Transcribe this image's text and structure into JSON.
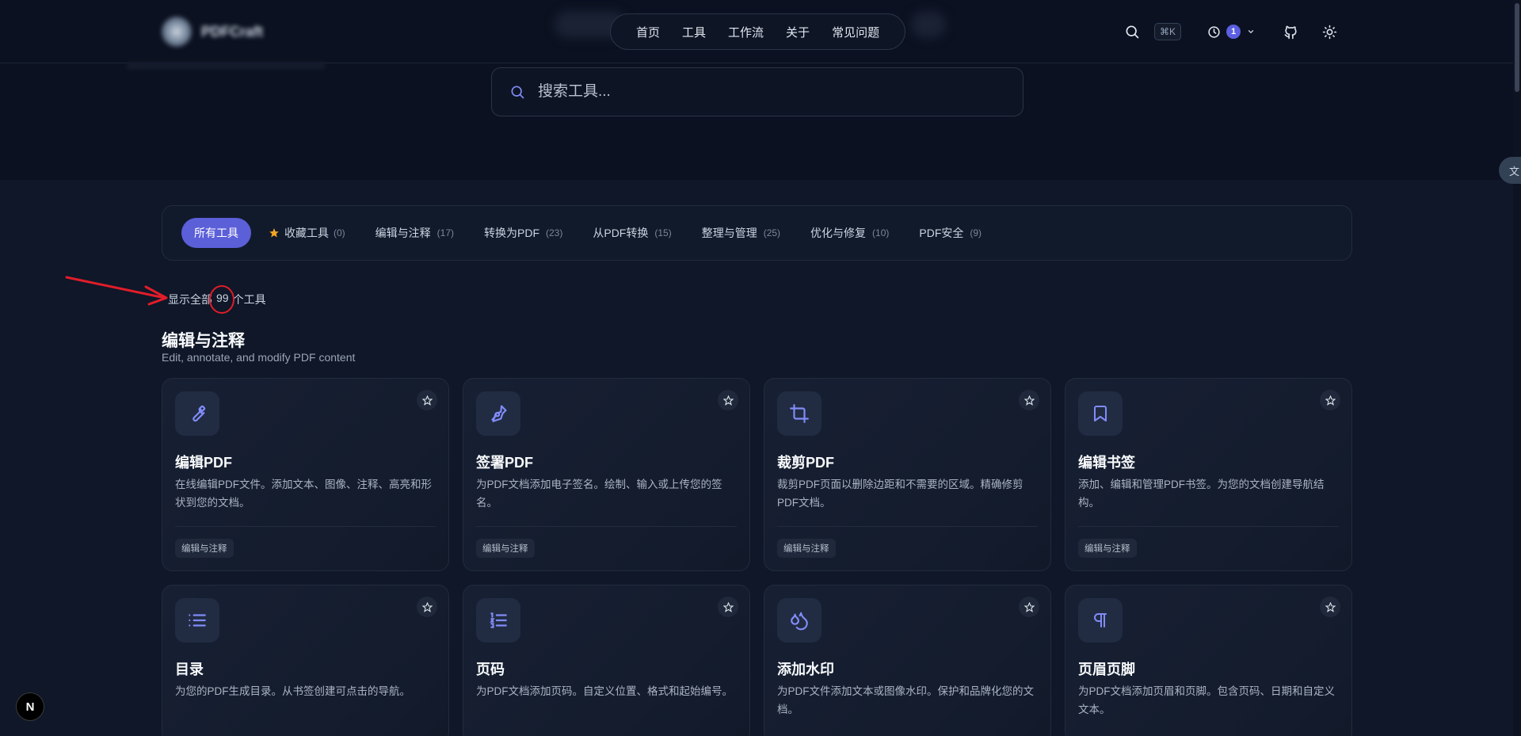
{
  "header": {
    "logo_text": "PDFCraft",
    "nav": [
      "首页",
      "工具",
      "工作流",
      "关于",
      "常见问题"
    ],
    "shortcut": "⌘K",
    "history_count": "1"
  },
  "search": {
    "placeholder": "搜索工具..."
  },
  "side_chip": "文",
  "filters": [
    {
      "label": "所有工具",
      "count": "",
      "active": true
    },
    {
      "label": "收藏工具",
      "count": "(0)",
      "icon": "star-icon"
    },
    {
      "label": "编辑与注释",
      "count": "(17)"
    },
    {
      "label": "转换为PDF",
      "count": "(23)"
    },
    {
      "label": "从PDF转换",
      "count": "(15)"
    },
    {
      "label": "整理与管理",
      "count": "(25)"
    },
    {
      "label": "优化与修复",
      "count": "(10)"
    },
    {
      "label": "PDF安全",
      "count": "(9)"
    }
  ],
  "count_line": {
    "prefix": "显示全部",
    "number": "99",
    "suffix": "个工具"
  },
  "section": {
    "title": "编辑与注释",
    "subtitle": "Edit, annotate, and modify PDF content"
  },
  "cards": [
    {
      "title": "编辑PDF",
      "desc": "在线编辑PDF文件。添加文本、图像、注释、高亮和形状到您的文档。",
      "tag": "编辑与注释",
      "icon": "wrench-icon"
    },
    {
      "title": "签署PDF",
      "desc": "为PDF文档添加电子签名。绘制、输入或上传您的签名。",
      "tag": "编辑与注释",
      "icon": "pen-icon"
    },
    {
      "title": "裁剪PDF",
      "desc": "裁剪PDF页面以删除边距和不需要的区域。精确修剪PDF文档。",
      "tag": "编辑与注释",
      "icon": "crop-icon"
    },
    {
      "title": "编辑书签",
      "desc": "添加、编辑和管理PDF书签。为您的文档创建导航结构。",
      "tag": "编辑与注释",
      "icon": "bookmark-icon"
    },
    {
      "title": "目录",
      "desc": "为您的PDF生成目录。从书签创建可点击的导航。",
      "tag": "",
      "icon": "list-icon"
    },
    {
      "title": "页码",
      "desc": "为PDF文档添加页码。自定义位置、格式和起始编号。",
      "tag": "",
      "icon": "numbered-list-icon"
    },
    {
      "title": "添加水印",
      "desc": "为PDF文件添加文本或图像水印。保护和品牌化您的文档。",
      "tag": "",
      "icon": "droplets-icon"
    },
    {
      "title": "页眉页脚",
      "desc": "为PDF文档添加页眉和页脚。包含页码、日期和自定义文本。",
      "tag": "",
      "icon": "pilcrow-icon"
    }
  ],
  "colors": {
    "accent": "#5b5fd8",
    "background": "#0b1120",
    "annotation": "#e11d2a"
  },
  "next_badge": "N"
}
